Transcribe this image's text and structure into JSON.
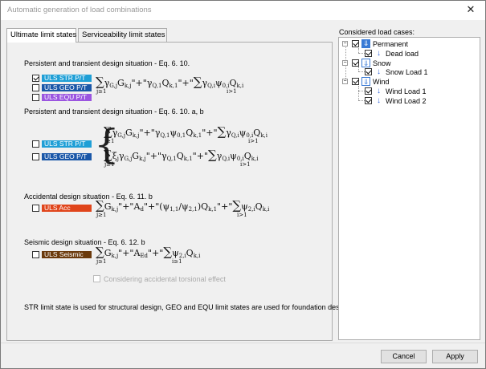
{
  "window": {
    "title": "Automatic generation of load combinations",
    "close_glyph": "✕"
  },
  "tabs": [
    {
      "label": "Ultimate limit states",
      "active": true
    },
    {
      "label": "Serviceability limit states",
      "active": false
    }
  ],
  "sections": {
    "persistent": {
      "title": "Persistent and transient design situation - Eq. 6. 10.",
      "items": [
        {
          "label": "ULS STR P/T",
          "checked": true,
          "color": "#1f9fd6"
        },
        {
          "label": "ULS GEO P/T",
          "checked": false,
          "color": "#1a57a8"
        },
        {
          "label": "ULS EQU P/T",
          "checked": false,
          "color": "#9b55e0"
        }
      ],
      "formula": "∑ γG,j Gk,j \"+\" γQ,1 Qk,1 \"+\" ∑ γQ,i ψ0,i Qk,i"
    },
    "persistent_ab": {
      "title": "Persistent and transient design situation - Eq. 6. 10. a, b",
      "items": [
        {
          "label": "ULS STR P/T",
          "checked": false,
          "color": "#1f9fd6"
        },
        {
          "label": "ULS GEO P/T",
          "checked": false,
          "color": "#1a57a8"
        }
      ],
      "formula_a": "∑ γG,j Gk,j \"+\" γQ,1 ψ0,1 Qk,1 \"+\" ∑ γQ,i ψ0,i Qk,i",
      "formula_b": "∑ ξj γG,j Gk,j \"+\" γQ,1 Qk,1 \"+\" ∑ γQ,i ψ0,i Qk,i"
    },
    "accidental": {
      "title": "Accidental design situation - Eq. 6. 11. b",
      "items": [
        {
          "label": "ULS Acc",
          "checked": false,
          "color": "#e0451b"
        }
      ],
      "formula": "∑ Gk,j \"+\" Ad \"+\" (ψ1,1 / ψ2,1) Qk,1 \"+\" ∑ ψ2,i Qk,i"
    },
    "seismic": {
      "title": "Seismic design situation - Eq. 6. 12. b",
      "items": [
        {
          "label": "ULS Seismic",
          "checked": false,
          "color": "#6b3a0c"
        }
      ],
      "formula": "∑ Gk,j \"+\" AEd \"+\" ∑ ψ2,i Qk,i",
      "torsional_label": "Considering accidental torsional effect"
    }
  },
  "note": "STR limit state is used for structural design, GEO and EQU limit states are used for foundation design",
  "right_panel": {
    "label": "Considered load cases:",
    "tree": [
      {
        "label": "Permanent",
        "type": "group",
        "children": [
          {
            "label": "Dead load"
          }
        ]
      },
      {
        "label": "Snow",
        "type": "group",
        "children": [
          {
            "label": "Snow Load 1"
          }
        ]
      },
      {
        "label": "Wind",
        "type": "group",
        "children": [
          {
            "label": "Wind Load 1"
          },
          {
            "label": "Wind Load 2"
          }
        ]
      }
    ]
  },
  "buttons": {
    "cancel": "Cancel",
    "apply": "Apply"
  }
}
